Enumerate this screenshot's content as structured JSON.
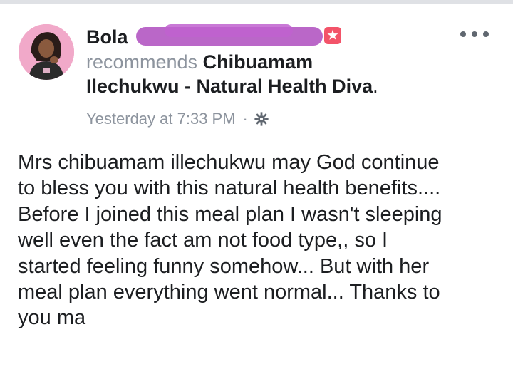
{
  "post": {
    "author": {
      "name_visible": "Bola"
    },
    "recommends_label": "recommends",
    "page_name_line1": "Chibuamam",
    "page_name_line2": "Ilechukwu - Natural Health Diva",
    "page_name_end": ".",
    "timestamp": "Yesterday at 7:33 PM",
    "separator": "·",
    "privacy_icon": "gear-icon",
    "recommend_icon": "star-badge-icon",
    "more_icon": "more-options-icon",
    "text": "Mrs chibuamam illechukwu  may God continue\nto bless you with this natural health benefits....\nBefore I joined this meal plan I wasn't sleeping\nwell even the fact am not food type,, so I\nstarted feeling funny somehow... But with her\nmeal plan everything went normal... Thanks to\nyou ma"
  },
  "colors": {
    "name": "#1c1e21",
    "meta": "#8d949e",
    "redaction": "#b45ac3",
    "badge": "#f35369"
  }
}
